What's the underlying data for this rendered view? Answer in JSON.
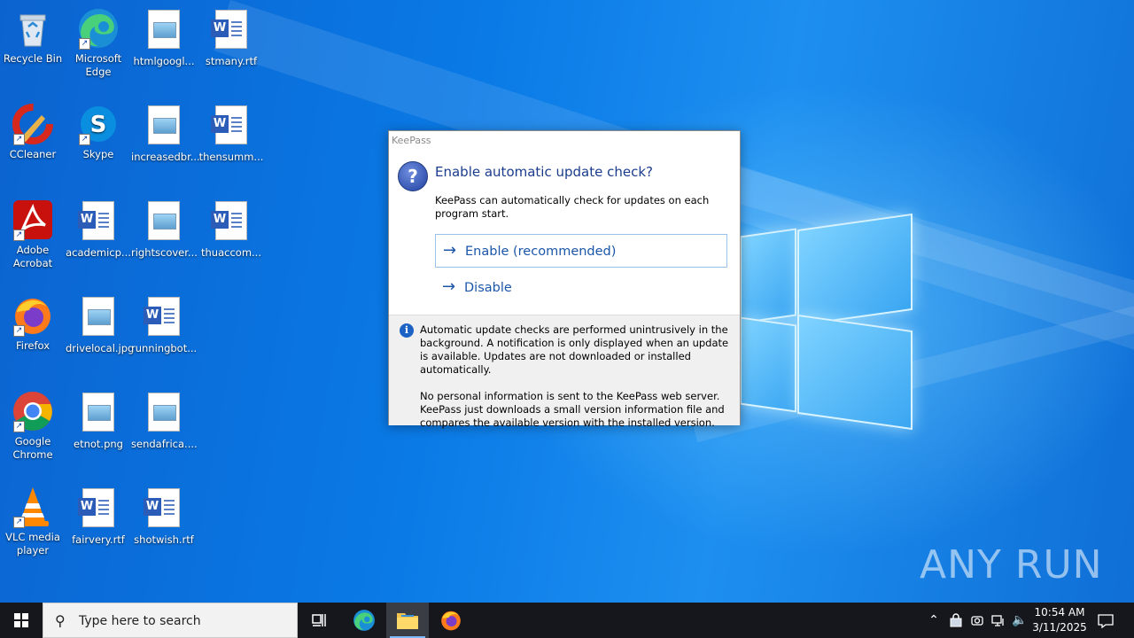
{
  "desktop": {
    "icons": [
      {
        "label": "Recycle Bin",
        "icon": "recycle-bin-icon"
      },
      {
        "label": "Microsoft Edge",
        "icon": "edge-icon"
      },
      {
        "label": "htmlgoogl...",
        "icon": "image-file-icon"
      },
      {
        "label": "stmany.rtf",
        "icon": "word-doc-icon"
      },
      {
        "label": "CCleaner",
        "icon": "ccleaner-icon"
      },
      {
        "label": "Skype",
        "icon": "skype-icon"
      },
      {
        "label": "increasedbr...",
        "icon": "image-file-icon"
      },
      {
        "label": "thensumm...",
        "icon": "word-doc-icon"
      },
      {
        "label": "Adobe Acrobat",
        "icon": "acrobat-icon"
      },
      {
        "label": "academicp...",
        "icon": "word-doc-icon"
      },
      {
        "label": "rightscover...",
        "icon": "image-file-icon"
      },
      {
        "label": "thuaccom...",
        "icon": "word-doc-icon"
      },
      {
        "label": "Firefox",
        "icon": "firefox-icon"
      },
      {
        "label": "drivelocal.jpg",
        "icon": "image-file-icon"
      },
      {
        "label": "runningbot...",
        "icon": "word-doc-icon"
      },
      {
        "label": "Google Chrome",
        "icon": "chrome-icon"
      },
      {
        "label": "etnot.png",
        "icon": "image-file-icon"
      },
      {
        "label": "sendafrica....",
        "icon": "image-file-icon"
      },
      {
        "label": "VLC media player",
        "icon": "vlc-icon"
      },
      {
        "label": "fairvery.rtf",
        "icon": "word-doc-icon"
      },
      {
        "label": "shotwish.rtf",
        "icon": "word-doc-icon"
      }
    ],
    "watermark": "ANY RUN"
  },
  "dialog": {
    "title": "KeePass",
    "main_instruction": "Enable automatic update check?",
    "content": "KeePass can automatically check for updates on each program start.",
    "enable_label": "Enable (recommended)",
    "disable_label": "Disable",
    "footer_p1": "Automatic update checks are performed unintrusively in the background. A notification is only displayed when an update is available. Updates are not downloaded or installed automatically.",
    "footer_p2": "No personal information is sent to the KeePass web server. KeePass just downloads a small version information file and compares the available version with the installed version."
  },
  "taskbar": {
    "search_placeholder": "Type here to search",
    "time": "10:54 AM",
    "date": "3/11/2025"
  }
}
